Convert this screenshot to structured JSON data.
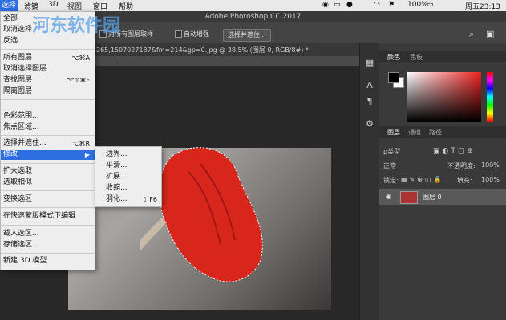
{
  "menubar": {
    "items": [
      "选择",
      "滤镜",
      "3D",
      "视图",
      "窗口",
      "帮助"
    ],
    "app_title": "Adobe Photoshop CC 2017",
    "battery": "100%",
    "clock": "周五23:13"
  },
  "options": {
    "sample_all_layers": "对所有图层取样",
    "auto_enhance": "自动增强",
    "select_and_mask": "选择并遮住..."
  },
  "doc": {
    "tab_text": "265,1507027187&fm=214&gp=0.jpg @ 38.5% (图层 0, RGB/8#) *"
  },
  "select_menu": {
    "items": [
      {
        "label": "全部",
        "shortcut": ""
      },
      {
        "label": "取消选择",
        "shortcut": ""
      },
      {
        "label": "反选",
        "shortcut": ""
      },
      {
        "label": "所有图层",
        "shortcut": "⌥⌘A"
      },
      {
        "label": "取消选择图层",
        "shortcut": ""
      },
      {
        "label": "查找图层",
        "shortcut": "⌥⇧⌘F"
      },
      {
        "label": "隔离图层",
        "shortcut": ""
      },
      {
        "label": "色彩范围...",
        "shortcut": ""
      },
      {
        "label": "焦点区域...",
        "shortcut": ""
      },
      {
        "label": "选择并遮住...",
        "shortcut": "⌥⌘R"
      },
      {
        "label": "修改",
        "shortcut": "▶"
      },
      {
        "label": "扩大选取",
        "shortcut": ""
      },
      {
        "label": "选取相似",
        "shortcut": ""
      },
      {
        "label": "变换选区",
        "shortcut": ""
      },
      {
        "label": "在快速蒙版模式下编辑",
        "shortcut": ""
      },
      {
        "label": "载入选区...",
        "shortcut": ""
      },
      {
        "label": "存储选区...",
        "shortcut": ""
      },
      {
        "label": "新建 3D 模型",
        "shortcut": ""
      }
    ]
  },
  "modify_submenu": {
    "items": [
      {
        "label": "边界...",
        "shortcut": ""
      },
      {
        "label": "平滑...",
        "shortcut": ""
      },
      {
        "label": "扩展...",
        "shortcut": ""
      },
      {
        "label": "收缩...",
        "shortcut": ""
      },
      {
        "label": "羽化...",
        "shortcut": "⇧ F6"
      }
    ]
  },
  "panels": {
    "color_tabs": [
      "颜色",
      "色板"
    ],
    "layer_tabs": [
      "图层",
      "通道",
      "路径"
    ],
    "kind_filter": "ρ类型",
    "blend_mode": "正常",
    "opacity_label": "不透明度:",
    "opacity_value": "100%",
    "lock_label": "锁定:",
    "fill_label": "填充:",
    "fill_value": "100%",
    "layer_name": "图层 0"
  },
  "watermark": "河东软件园",
  "colors": {
    "menu_highlight": "#2d6fe0",
    "fg": "#000000",
    "bg": "#ffffff",
    "dress": "#d8261c"
  },
  "icons": [
    "apple-icon",
    "wifi-icon",
    "battery-icon",
    "search-icon",
    "eye-icon",
    "arrow-right-icon"
  ]
}
